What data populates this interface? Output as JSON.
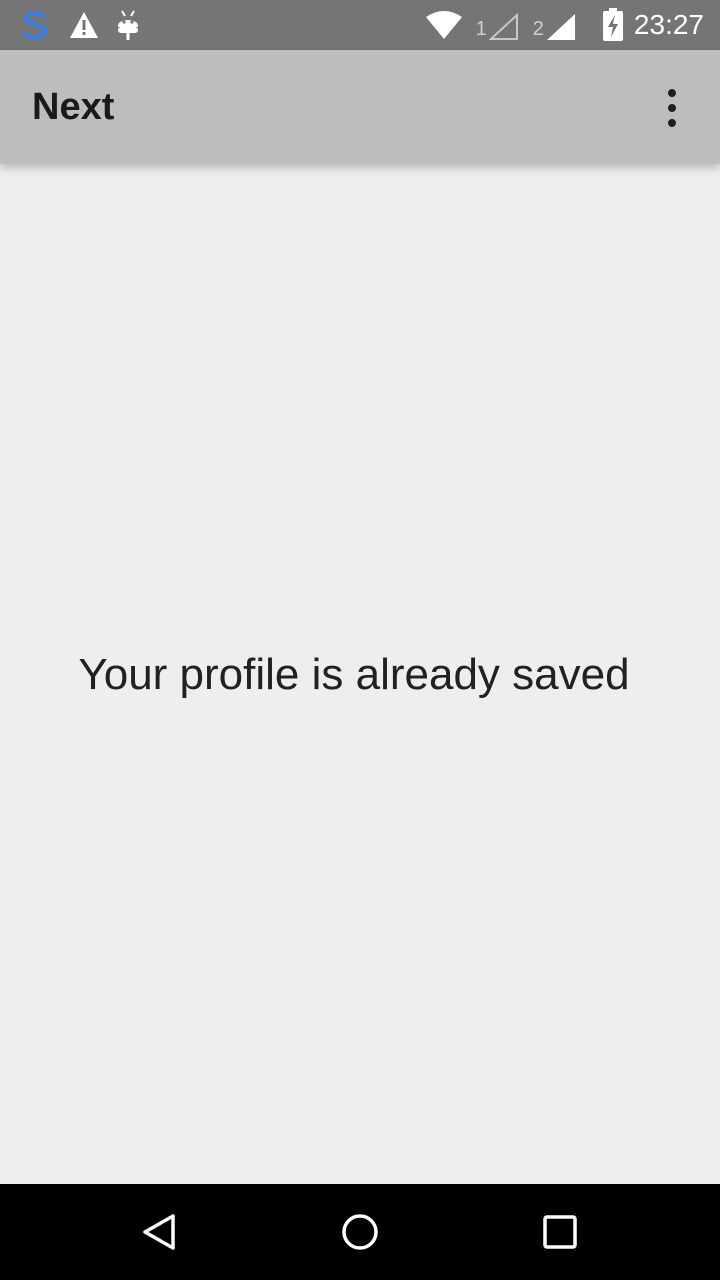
{
  "status_bar": {
    "left_icons": [
      "s-app-icon",
      "warning-icon",
      "android-debug-icon"
    ],
    "sim1_label": "1",
    "sim2_label": "2",
    "time": "23:27"
  },
  "app_bar": {
    "title": "Next",
    "overflow_icon": "more-vert-icon"
  },
  "content": {
    "message": "Your profile is already saved"
  },
  "nav_bar": {
    "buttons": [
      "back-icon",
      "home-icon",
      "recents-icon"
    ]
  },
  "colors": {
    "status_bar": "#757575",
    "app_bar": "#bdbdbd",
    "background": "#eeeeee",
    "nav_bar": "#000000",
    "s_app_accent": "#3d7bdc"
  }
}
